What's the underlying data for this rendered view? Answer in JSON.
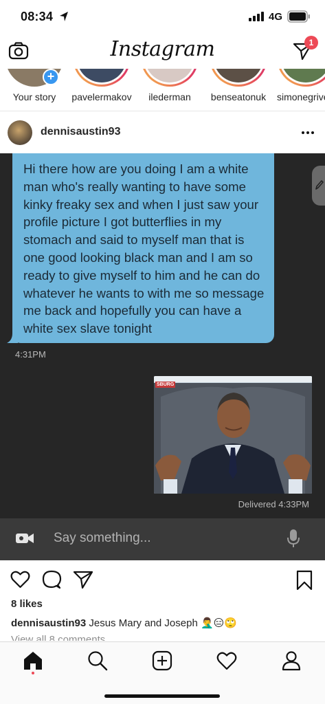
{
  "status_bar": {
    "time": "08:34",
    "network": "4G"
  },
  "header": {
    "logo": "Instagram",
    "dm_badge": "1"
  },
  "stories": [
    {
      "name": "Your story"
    },
    {
      "name": "pavelermakov"
    },
    {
      "name": "ilederman"
    },
    {
      "name": "benseatonuk"
    },
    {
      "name": "simonegrive"
    }
  ],
  "post": {
    "username": "dennisaustin93",
    "image": {
      "message_text": "Hi there how are you doing I am a white man who's really wanting to have some kinky freaky sex and when I just saw your profile picture I got butterflies in my stomach and said to myself man that is one good looking black man and I am so ready to give myself to him and he can do whatever he wants to with me so message me back and hopefully you can have a white sex slave tonight",
      "received_time": "4:31PM",
      "photo_tag": "SBURG",
      "delivered_status": "Delivered  4:33PM",
      "compose_placeholder": "Say something..."
    },
    "likes": "8 likes",
    "caption_user": "dennisaustin93",
    "caption_text": "Jesus Mary and Joseph 🤦‍♂️😑🙄",
    "view_comments": "View all 8 comments"
  },
  "icons": {
    "status": [
      "location-arrow-icon",
      "signal-icon",
      "battery-icon"
    ],
    "header": [
      "camera-icon",
      "direct-message-icon"
    ],
    "post": [
      "more-options-icon",
      "like-icon",
      "comment-icon",
      "share-icon",
      "bookmark-icon"
    ],
    "chat": [
      "pencil-icon",
      "video-camera-icon",
      "microphone-icon"
    ],
    "tabs": [
      "home-icon",
      "search-icon",
      "new-post-icon",
      "activity-icon",
      "profile-icon"
    ]
  },
  "colors": {
    "badge": "#ed4956",
    "story_plus": "#3897f0",
    "chat_bubble": "#6fb6dc",
    "chat_background": "#262626"
  }
}
